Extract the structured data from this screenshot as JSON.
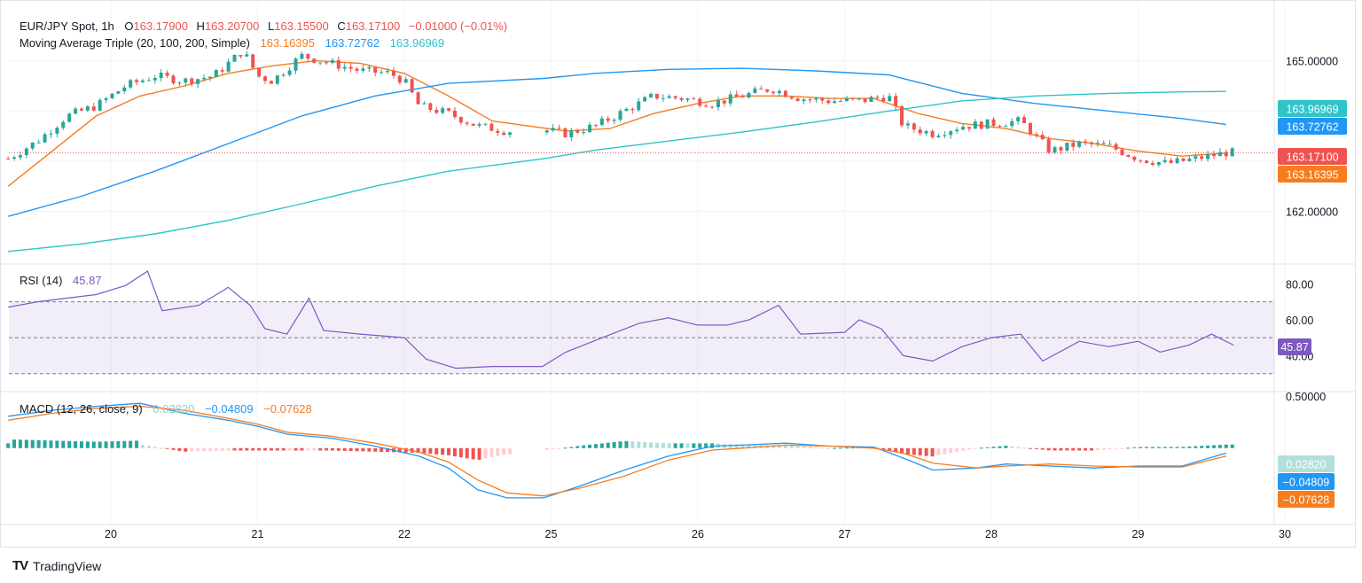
{
  "price_legend": {
    "symbol": "EUR/JPY Spot, 1h",
    "o_label": "O",
    "o_val": "163.17900",
    "h_label": "H",
    "h_val": "163.20700",
    "l_label": "L",
    "l_val": "163.15500",
    "c_label": "C",
    "c_val": "163.17100",
    "change": "−0.01000 (−0.01%)"
  },
  "ma_legend": {
    "name": "Moving Average Triple (20, 100, 200, Simple)",
    "v1": "163.16395",
    "v2": "163.72762",
    "v3": "163.96969"
  },
  "rsi_legend": {
    "name": "RSI (14)",
    "value": "45.87"
  },
  "macd_legend": {
    "name": "MACD (12, 26, close, 9)",
    "v1": "0.02820",
    "v2": "−0.04809",
    "v3": "−0.07628"
  },
  "price_axis": [
    "165.00000",
    "162.00000"
  ],
  "rsi_axis": [
    "80.00",
    "60.00",
    "40.00"
  ],
  "macd_axis": [
    "0.50000"
  ],
  "badges": {
    "ma200": "163.96969",
    "ma100": "163.72762",
    "last": "163.17100",
    "ma20": "163.16395",
    "rsi": "45.87",
    "hist": "0.02820",
    "macd": "−0.04809",
    "signal": "−0.07628"
  },
  "x_labels": [
    "20",
    "21",
    "22",
    "25",
    "26",
    "27",
    "28",
    "29",
    "30"
  ],
  "brand": "TradingView",
  "colors": {
    "up": "#26a69a",
    "down": "#ef5350",
    "ma20": "#f57c1f",
    "ma100": "#2196f3",
    "ma200": "#2ec4c9",
    "rsi": "#7e57c2",
    "hist_up_strong": "#26a69a",
    "hist_up_weak": "#b2dfdb",
    "hist_down_strong": "#ef5350",
    "hist_down_weak": "#ffcdd2",
    "macd": "#2196f3",
    "signal": "#f57c1f"
  },
  "chart_data": [
    {
      "type": "candlestick",
      "title": "EUR/JPY Spot, 1h",
      "x": [
        "20",
        "21",
        "22",
        "25",
        "26",
        "27",
        "28",
        "29",
        "30"
      ],
      "ylim": [
        160.95,
        166.0
      ],
      "close_path": [
        [
          19.3,
          163.05
        ],
        [
          19.5,
          163.4
        ],
        [
          19.7,
          163.9
        ],
        [
          19.9,
          164.1
        ],
        [
          20.1,
          164.5
        ],
        [
          20.3,
          164.7
        ],
        [
          20.5,
          164.6
        ],
        [
          20.7,
          164.7
        ],
        [
          20.9,
          165.2
        ],
        [
          21.0,
          164.7
        ],
        [
          21.1,
          164.6
        ],
        [
          21.3,
          165.1
        ],
        [
          21.5,
          164.95
        ],
        [
          21.7,
          164.8
        ],
        [
          21.9,
          164.75
        ],
        [
          22.0,
          164.6
        ],
        [
          22.1,
          164.1
        ],
        [
          22.3,
          163.95
        ],
        [
          22.5,
          163.7
        ],
        [
          22.7,
          163.6
        ],
        [
          24.9,
          163.65
        ],
        [
          25.1,
          163.55
        ],
        [
          25.3,
          163.7
        ],
        [
          25.5,
          164.0
        ],
        [
          25.7,
          164.3
        ],
        [
          25.9,
          164.25
        ],
        [
          26.1,
          164.15
        ],
        [
          26.3,
          164.3
        ],
        [
          26.5,
          164.45
        ],
        [
          26.7,
          164.25
        ],
        [
          26.9,
          164.2
        ],
        [
          27.1,
          164.2
        ],
        [
          27.3,
          164.3
        ],
        [
          27.4,
          163.7
        ],
        [
          27.6,
          163.55
        ],
        [
          27.8,
          163.7
        ],
        [
          28.0,
          163.75
        ],
        [
          28.2,
          163.8
        ],
        [
          28.4,
          163.2
        ],
        [
          28.6,
          163.35
        ],
        [
          28.8,
          163.3
        ],
        [
          29.0,
          163.05
        ],
        [
          29.2,
          162.95
        ],
        [
          29.4,
          163.05
        ],
        [
          29.6,
          163.17
        ]
      ],
      "series": [
        {
          "name": "MA 20",
          "points": [
            [
              19.3,
              162.5
            ],
            [
              19.6,
              163.2
            ],
            [
              19.9,
              163.9
            ],
            [
              20.2,
              164.3
            ],
            [
              20.5,
              164.5
            ],
            [
              20.8,
              164.75
            ],
            [
              21.1,
              164.9
            ],
            [
              21.4,
              165.0
            ],
            [
              21.7,
              164.95
            ],
            [
              22.0,
              164.75
            ],
            [
              22.3,
              164.3
            ],
            [
              22.6,
              163.8
            ],
            [
              25.1,
              163.6
            ],
            [
              25.4,
              163.65
            ],
            [
              25.7,
              163.95
            ],
            [
              26.0,
              164.15
            ],
            [
              26.3,
              164.3
            ],
            [
              26.6,
              164.3
            ],
            [
              26.9,
              164.25
            ],
            [
              27.2,
              164.25
            ],
            [
              27.5,
              163.95
            ],
            [
              27.8,
              163.75
            ],
            [
              28.1,
              163.65
            ],
            [
              28.4,
              163.45
            ],
            [
              28.7,
              163.35
            ],
            [
              29.0,
              163.2
            ],
            [
              29.3,
              163.1
            ],
            [
              29.6,
              163.16
            ]
          ]
        },
        {
          "name": "MA 100",
          "points": [
            [
              19.3,
              161.9
            ],
            [
              19.8,
              162.3
            ],
            [
              20.3,
              162.8
            ],
            [
              20.8,
              163.35
            ],
            [
              21.3,
              163.9
            ],
            [
              21.8,
              164.3
            ],
            [
              22.3,
              164.55
            ],
            [
              24.95,
              164.65
            ],
            [
              25.3,
              164.75
            ],
            [
              25.8,
              164.83
            ],
            [
              26.3,
              164.85
            ],
            [
              26.8,
              164.8
            ],
            [
              27.3,
              164.72
            ],
            [
              27.8,
              164.35
            ],
            [
              28.3,
              164.15
            ],
            [
              28.8,
              164.0
            ],
            [
              29.3,
              163.85
            ],
            [
              29.6,
              163.73
            ]
          ]
        },
        {
          "name": "MA 200",
          "points": [
            [
              19.3,
              161.2
            ],
            [
              19.8,
              161.35
            ],
            [
              20.3,
              161.55
            ],
            [
              20.8,
              161.82
            ],
            [
              21.3,
              162.15
            ],
            [
              21.8,
              162.5
            ],
            [
              22.3,
              162.8
            ],
            [
              24.95,
              163.05
            ],
            [
              25.3,
              163.22
            ],
            [
              25.8,
              163.4
            ],
            [
              26.3,
              163.58
            ],
            [
              26.8,
              163.78
            ],
            [
              27.3,
              164.0
            ],
            [
              27.8,
              164.2
            ],
            [
              28.3,
              164.3
            ],
            [
              28.8,
              164.35
            ],
            [
              29.3,
              164.38
            ],
            [
              29.6,
              164.39
            ]
          ]
        }
      ]
    },
    {
      "type": "line",
      "title": "RSI (14)",
      "ylim": [
        20,
        90
      ],
      "bands": [
        30,
        50,
        70
      ],
      "series": [
        {
          "name": "RSI (14)",
          "points": [
            [
              19.3,
              67
            ],
            [
              19.5,
              70
            ],
            [
              19.7,
              72
            ],
            [
              19.9,
              74
            ],
            [
              20.1,
              79
            ],
            [
              20.25,
              87
            ],
            [
              20.35,
              65
            ],
            [
              20.6,
              68
            ],
            [
              20.8,
              78
            ],
            [
              20.95,
              68
            ],
            [
              21.05,
              55
            ],
            [
              21.2,
              52
            ],
            [
              21.35,
              72
            ],
            [
              21.45,
              54
            ],
            [
              21.7,
              52
            ],
            [
              22.0,
              50
            ],
            [
              22.15,
              38
            ],
            [
              22.35,
              33
            ],
            [
              22.6,
              34
            ],
            [
              24.85,
              34
            ],
            [
              25.1,
              42
            ],
            [
              25.35,
              50
            ],
            [
              25.6,
              58
            ],
            [
              25.8,
              61
            ],
            [
              26.0,
              57
            ],
            [
              26.2,
              57
            ],
            [
              26.35,
              60
            ],
            [
              26.55,
              68
            ],
            [
              26.7,
              52
            ],
            [
              27.0,
              53
            ],
            [
              27.1,
              60
            ],
            [
              27.25,
              55
            ],
            [
              27.4,
              40
            ],
            [
              27.6,
              37
            ],
            [
              27.8,
              45
            ],
            [
              28.0,
              50
            ],
            [
              28.2,
              52
            ],
            [
              28.35,
              37
            ],
            [
              28.6,
              48
            ],
            [
              28.8,
              45
            ],
            [
              29.0,
              48
            ],
            [
              29.15,
              42
            ],
            [
              29.35,
              46
            ],
            [
              29.5,
              52
            ],
            [
              29.65,
              45.87
            ]
          ]
        }
      ]
    },
    {
      "type": "bar",
      "title": "MACD (12, 26, close, 9)",
      "ylim": [
        -0.75,
        0.55
      ],
      "series": [
        {
          "name": "MACD",
          "points": [
            [
              19.3,
              0.32
            ],
            [
              19.6,
              0.38
            ],
            [
              19.9,
              0.42
            ],
            [
              20.2,
              0.45
            ],
            [
              20.5,
              0.35
            ],
            [
              20.8,
              0.28
            ],
            [
              21.0,
              0.22
            ],
            [
              21.2,
              0.14
            ],
            [
              21.5,
              0.1
            ],
            [
              21.8,
              0.02
            ],
            [
              22.1,
              -0.08
            ],
            [
              22.3,
              -0.2
            ],
            [
              22.5,
              -0.42
            ],
            [
              22.7,
              -0.5
            ],
            [
              24.95,
              -0.5
            ],
            [
              25.2,
              -0.38
            ],
            [
              25.5,
              -0.22
            ],
            [
              25.8,
              -0.08
            ],
            [
              26.1,
              0.02
            ],
            [
              26.3,
              0.03
            ],
            [
              26.6,
              0.05
            ],
            [
              26.9,
              0.02
            ],
            [
              27.2,
              0.01
            ],
            [
              27.4,
              -0.1
            ],
            [
              27.6,
              -0.22
            ],
            [
              27.9,
              -0.2
            ],
            [
              28.1,
              -0.16
            ],
            [
              28.4,
              -0.18
            ],
            [
              28.7,
              -0.2
            ],
            [
              29.0,
              -0.18
            ],
            [
              29.3,
              -0.18
            ],
            [
              29.6,
              -0.05
            ]
          ]
        },
        {
          "name": "Signal",
          "points": [
            [
              19.3,
              0.28
            ],
            [
              19.6,
              0.35
            ],
            [
              19.9,
              0.4
            ],
            [
              20.2,
              0.42
            ],
            [
              20.5,
              0.38
            ],
            [
              20.8,
              0.3
            ],
            [
              21.0,
              0.24
            ],
            [
              21.2,
              0.16
            ],
            [
              21.5,
              0.12
            ],
            [
              21.8,
              0.05
            ],
            [
              22.1,
              -0.04
            ],
            [
              22.3,
              -0.14
            ],
            [
              22.5,
              -0.32
            ],
            [
              22.7,
              -0.45
            ],
            [
              24.95,
              -0.48
            ],
            [
              25.2,
              -0.4
            ],
            [
              25.5,
              -0.28
            ],
            [
              25.8,
              -0.12
            ],
            [
              26.1,
              -0.02
            ],
            [
              26.3,
              0.0
            ],
            [
              26.6,
              0.03
            ],
            [
              26.9,
              0.02
            ],
            [
              27.2,
              0.0
            ],
            [
              27.4,
              -0.05
            ],
            [
              27.6,
              -0.15
            ],
            [
              27.9,
              -0.2
            ],
            [
              28.1,
              -0.18
            ],
            [
              28.4,
              -0.16
            ],
            [
              28.7,
              -0.18
            ],
            [
              29.0,
              -0.19
            ],
            [
              29.3,
              -0.19
            ],
            [
              29.6,
              -0.08
            ]
          ]
        }
      ]
    }
  ]
}
